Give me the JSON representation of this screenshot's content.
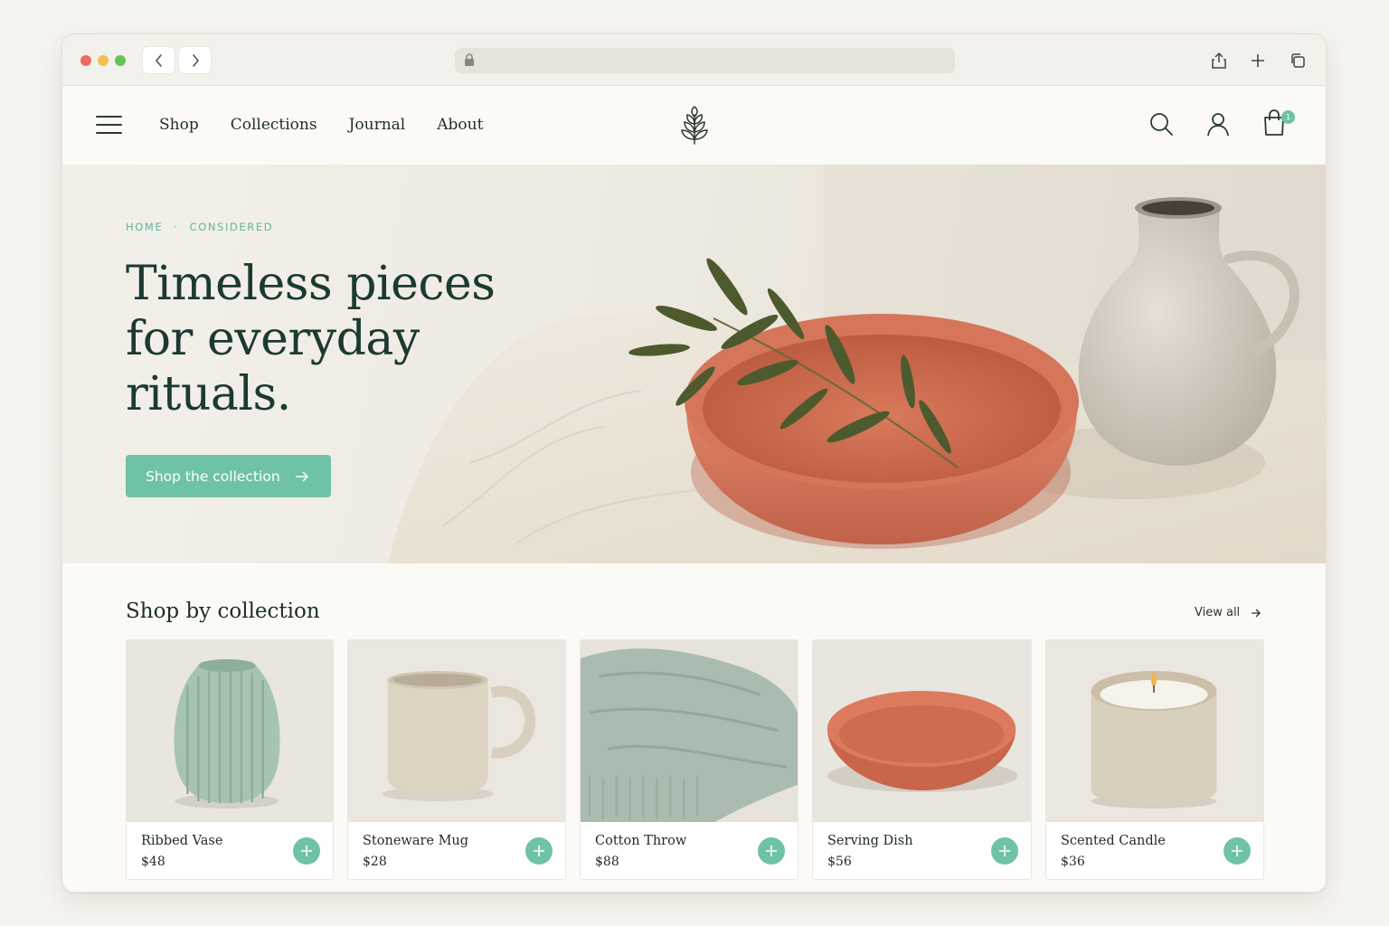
{
  "colors": {
    "accent": "#6ec3a6",
    "heading": "#1b3a30",
    "terracotta": "#d9765a"
  },
  "browser": {
    "back_icon": "chevron-left-icon",
    "forward_icon": "chevron-right-icon",
    "address_icon": "lock-icon",
    "actions": [
      "share-icon",
      "plus-icon",
      "tabs-icon"
    ]
  },
  "header": {
    "menu_icon": "hamburger-icon",
    "nav": [
      "Shop",
      "Collections",
      "Journal",
      "About"
    ],
    "logo_icon": "leaf-logo-icon",
    "icons": [
      "search-icon",
      "user-icon",
      "cart-icon"
    ],
    "cart_count": "1"
  },
  "hero": {
    "breadcrumb": [
      "HOME",
      "CONSIDERED"
    ],
    "title": "Timeless pieces for everyday rituals.",
    "cta_label": "Shop the collection"
  },
  "collections": {
    "title": "Shop by collection",
    "view_all": "View all",
    "products": [
      {
        "name": "Ribbed Vase",
        "price": "$48"
      },
      {
        "name": "Stoneware Mug",
        "price": "$28"
      },
      {
        "name": "Cotton Throw",
        "price": "$88"
      },
      {
        "name": "Serving Dish",
        "price": "$56"
      },
      {
        "name": "Scented Candle",
        "price": "$36"
      }
    ]
  }
}
